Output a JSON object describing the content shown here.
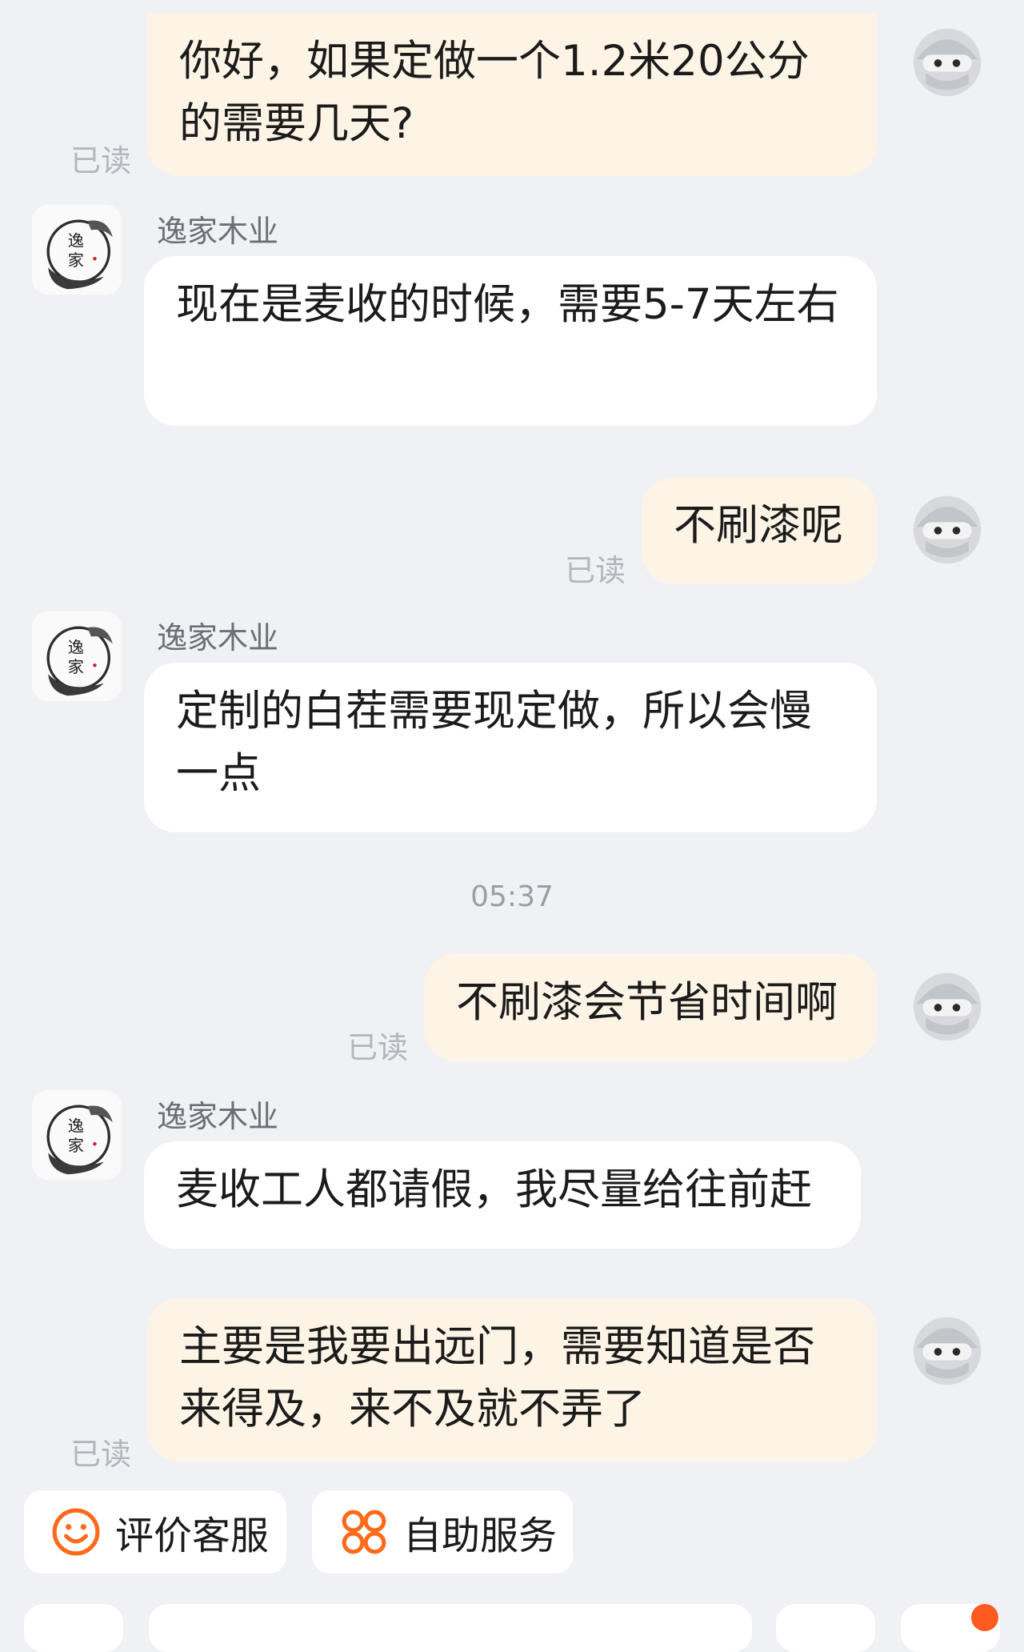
{
  "conversation": {
    "messages": [
      {
        "side": "right",
        "text": "你好，如果定做一个1.2米20公分的需要几天?",
        "read": "已读"
      },
      {
        "side": "left",
        "sender": "逸家木业",
        "text": "现在是麦收的时候，需要5-7天左右"
      },
      {
        "side": "right",
        "text": "不刷漆呢",
        "read": "已读"
      },
      {
        "side": "left",
        "sender": "逸家木业",
        "text": "定制的白茬需要现定做，所以会慢一点"
      },
      {
        "side": "right",
        "text": "不刷漆会节省时间啊",
        "read": "已读"
      },
      {
        "side": "left",
        "sender": "逸家木业",
        "text": "麦收工人都请假，我尽量给往前赶"
      },
      {
        "side": "right",
        "text": "主要是我要出远门，需要知道是否来得及，来不及就不弄了",
        "read": "已读"
      }
    ],
    "timestamp": "05:37"
  },
  "quick_actions": [
    {
      "label": "评价客服",
      "icon": "smiley-icon",
      "color": "#ff6a1a"
    },
    {
      "label": "自助服务",
      "icon": "grid-circles-icon",
      "color": "#ff6a1a"
    }
  ],
  "shop": {
    "name": "逸家木业",
    "avatar_text": [
      "逸",
      "家"
    ]
  }
}
